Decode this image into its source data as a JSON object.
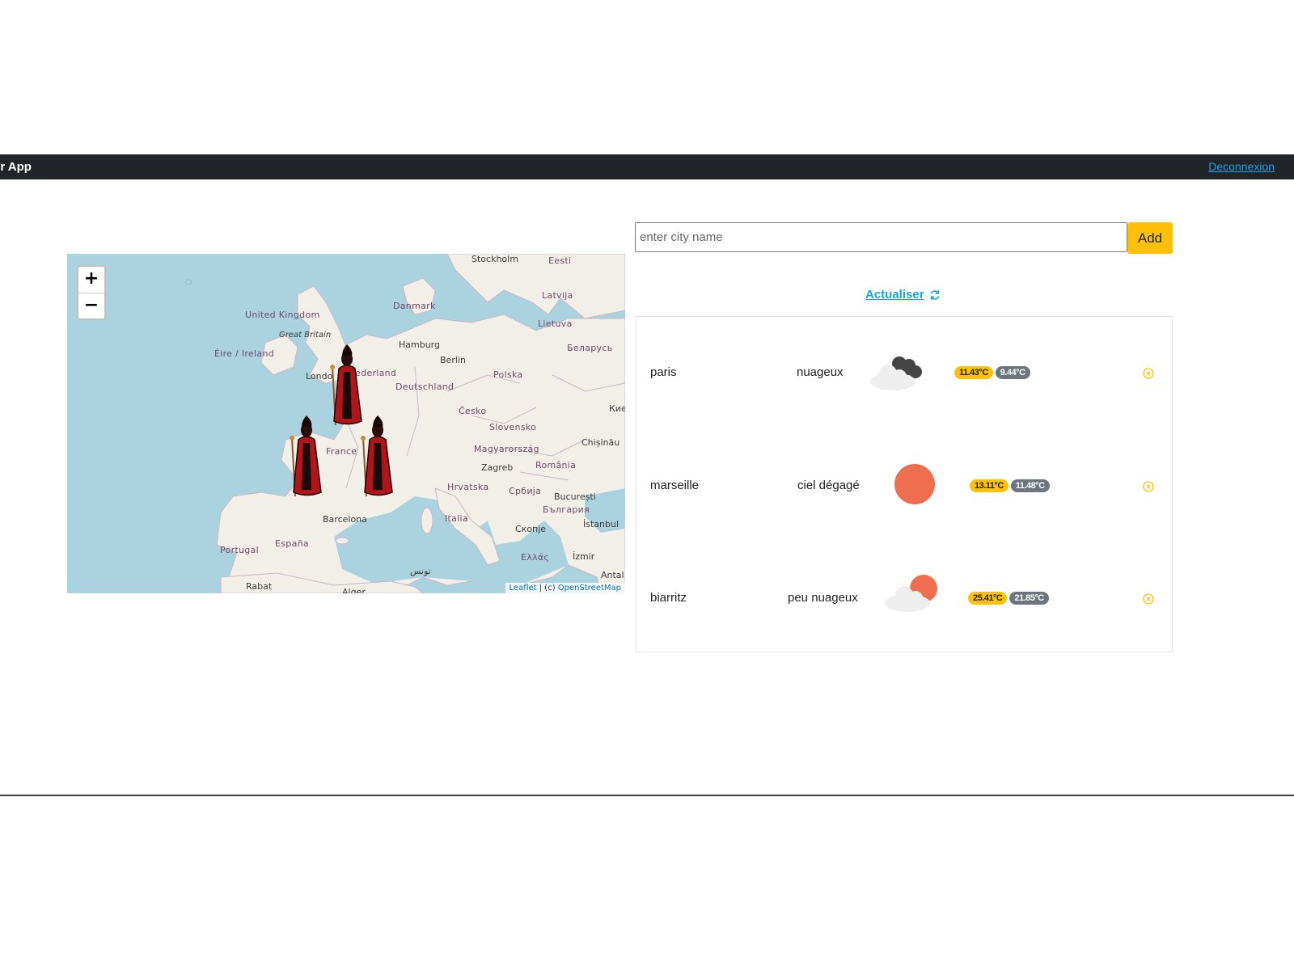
{
  "navbar": {
    "brand": "er App",
    "logout_label": "Deconnexion",
    "bg_color": "#212529",
    "link_color": "#17a2e6"
  },
  "map": {
    "zoom_in": "+",
    "zoom_out": "−",
    "attribution": {
      "leaflet": "Leaflet",
      "separator": " | (c) ",
      "osm": "OpenStreetMap"
    },
    "labels": {
      "stockholm": "Stockholm",
      "eesti": "Eesti",
      "latvija": "Latvija",
      "danmark": "Danmark",
      "lietuva": "Lietuva",
      "united_kingdom": "United Kingdom",
      "great_britain": "Great Britain",
      "hamburg": "Hamburg",
      "belarus": "Беларусь",
      "eire": "Éire / Ireland",
      "berlin": "Berlin",
      "nederland": "ederland",
      "london": "Londo",
      "polska": "Polska",
      "deutschland": "Deutschland",
      "kyiv": "Кие",
      "cesko": "Česko",
      "slovensko": "Slovensko",
      "chisinau": "Chișinău",
      "france": "France",
      "magyarorszag": "Magyarország",
      "zagreb": "Zagreb",
      "romania": "România",
      "hrvatska": "Hrvatska",
      "srbija": "Србија",
      "bucuresti": "București",
      "bulgaria": "България",
      "barcelona": "Barcelona",
      "italia": "Italia",
      "istanbul": "İstanbul",
      "skopje": "Скопје",
      "portugal": "Portugal",
      "espana": "España",
      "ellas": "Ελλάς",
      "izmir": "İzmir",
      "tunis": "تونس",
      "antal": "Antal",
      "rabat": "Rabat",
      "alger": "Alger"
    },
    "marker_icon": "villain-marker-icon"
  },
  "search": {
    "placeholder": "enter city name",
    "value": "",
    "add_label": "Add"
  },
  "refresh": {
    "label": "Actualiser",
    "icon": "refresh-icon"
  },
  "cities": [
    {
      "name": "paris",
      "description": "nuageux",
      "icon": "broken-clouds-icon",
      "temp_max": "11.43°C",
      "temp_min": "9.44°C"
    },
    {
      "name": "marseille",
      "description": "ciel dégagé",
      "icon": "clear-sky-icon",
      "temp_max": "13.11°C",
      "temp_min": "11.48°C"
    },
    {
      "name": "biarritz",
      "description": "peu nuageux",
      "icon": "few-clouds-icon",
      "temp_max": "25.41°C",
      "temp_min": "21.85°C"
    }
  ],
  "colors": {
    "accent": "#ffc107",
    "secondary": "#6c757d",
    "sun": "#ee6e4d",
    "map_water": "#aad3df",
    "map_land": "#f2efe9"
  }
}
